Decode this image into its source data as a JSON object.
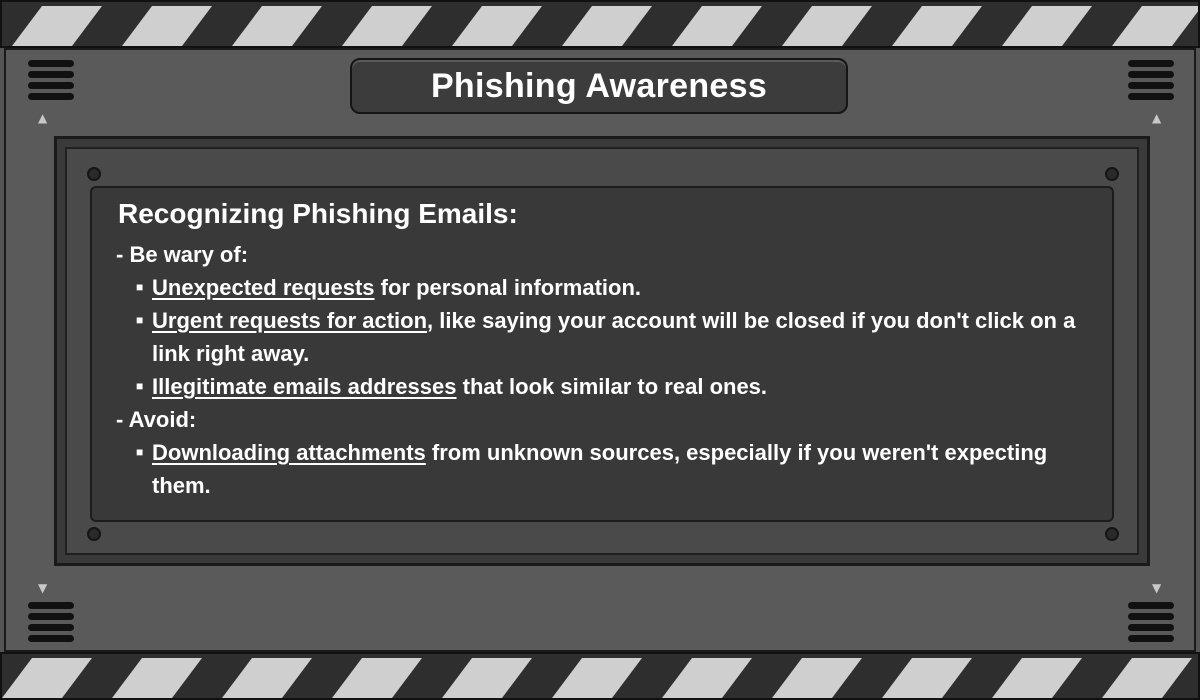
{
  "title": "Phishing Awareness",
  "heading": "Recognizing Phishing Emails:",
  "sections": [
    {
      "label": "- Be wary of:",
      "items": [
        {
          "highlight": "Unexpected requests",
          "rest": " for personal information."
        },
        {
          "highlight": "Urgent requests for action",
          "rest": ", like saying your account will be closed if you don't click on a link right away."
        },
        {
          "highlight": "Illegitimate emails addresses",
          "rest": " that look similar to real ones."
        }
      ]
    },
    {
      "label": "- Avoid:",
      "items": [
        {
          "highlight": "Downloading attachments",
          "rest": " from unknown sources, especially if you weren't expecting them."
        }
      ]
    }
  ],
  "colors": {
    "text": "#ffffff",
    "panel": "#5a5a5a",
    "screen": "#393939"
  },
  "icons": {
    "bullet": "square-bullet-icon",
    "arrow_up": "arrow-up-icon",
    "arrow_down": "arrow-down-icon",
    "vent": "vent-icon"
  }
}
